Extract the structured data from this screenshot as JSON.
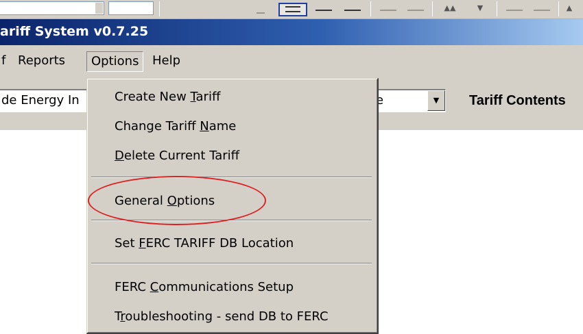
{
  "window": {
    "title": "ariff System v0.7.25"
  },
  "menu_bar": {
    "tariff_fragment": "f",
    "reports": "Reports",
    "options": "Options",
    "help": "Help"
  },
  "tariff_select": {
    "value": "de Energy In",
    "tail": "e",
    "dropdown_glyph": "▼"
  },
  "tariff_contents_label": "Tariff Contents",
  "options_menu": {
    "items": [
      {
        "before": "Create New ",
        "key": "T",
        "after": "ariff"
      },
      {
        "before": "Change Tariff ",
        "key": "N",
        "after": "ame"
      },
      {
        "before": "",
        "key": "D",
        "after": "elete Current Tariff"
      },
      {
        "before": "General ",
        "key": "O",
        "after": "ptions"
      },
      {
        "before": "Set ",
        "key": "F",
        "after": "ERC TARIFF DB Location"
      },
      {
        "before": "FERC ",
        "key": "C",
        "after": "ommunications Setup"
      },
      {
        "before": "T",
        "key": "r",
        "after": "oubleshooting - send DB to FERC"
      }
    ]
  },
  "annotation": {
    "highlight_color": "#e02020"
  },
  "colors": {
    "title_bar_start": "#0a246a",
    "title_bar_end": "#a6caf0",
    "menu_background": "#d4d0c8"
  }
}
